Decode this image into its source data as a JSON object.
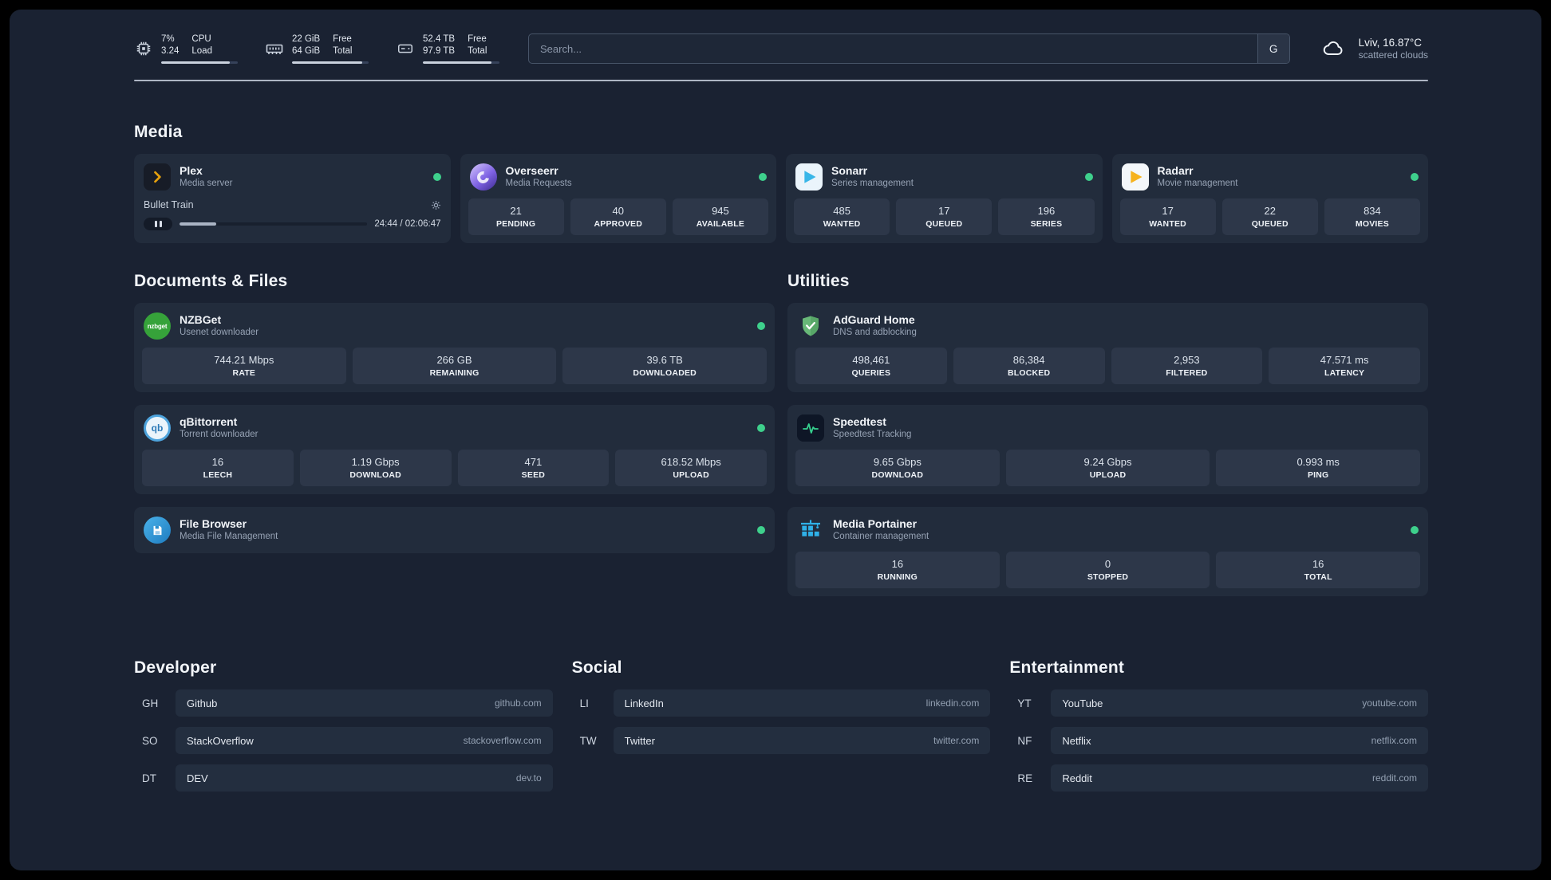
{
  "colors": {
    "status_online": "#3ed08c",
    "accent_plex": "#e5a00d",
    "accent_sonarr": "#38b6e8",
    "accent_radarr": "#f6b21e",
    "accent_adguard": "#68b878",
    "accent_speedtest": "#36d28f",
    "accent_portainer": "#2fb1e8"
  },
  "topbar": {
    "resources": [
      {
        "icon": "cpu-icon",
        "value_top": "7%",
        "value_bottom": "3.24",
        "label_top": "CPU",
        "label_bottom": "Load",
        "percent": 90
      },
      {
        "icon": "memory-icon",
        "value_top": "22 GiB",
        "value_bottom": "64 GiB",
        "label_top": "Free",
        "label_bottom": "Total",
        "percent": 92
      },
      {
        "icon": "disk-icon",
        "value_top": "52.4 TB",
        "value_bottom": "97.9 TB",
        "label_top": "Free",
        "label_bottom": "Total",
        "percent": 90
      }
    ],
    "search": {
      "placeholder": "Search...",
      "provider_label": "G"
    },
    "weather": {
      "line1": "Lviv, 16.87°C",
      "line2": "scattered clouds"
    }
  },
  "media": {
    "title": "Media",
    "plex": {
      "name": "Plex",
      "desc": "Media server",
      "player": {
        "track": "Bullet Train",
        "time": "24:44 / 02:06:47",
        "progress_percent": 19.5
      }
    },
    "overseerr": {
      "name": "Overseerr",
      "desc": "Media Requests",
      "stats": [
        {
          "value": "21",
          "label": "PENDING"
        },
        {
          "value": "40",
          "label": "APPROVED"
        },
        {
          "value": "945",
          "label": "AVAILABLE"
        }
      ]
    },
    "sonarr": {
      "name": "Sonarr",
      "desc": "Series management",
      "stats": [
        {
          "value": "485",
          "label": "WANTED"
        },
        {
          "value": "17",
          "label": "QUEUED"
        },
        {
          "value": "196",
          "label": "SERIES"
        }
      ]
    },
    "radarr": {
      "name": "Radarr",
      "desc": "Movie management",
      "stats": [
        {
          "value": "17",
          "label": "WANTED"
        },
        {
          "value": "22",
          "label": "QUEUED"
        },
        {
          "value": "834",
          "label": "MOVIES"
        }
      ]
    }
  },
  "documents": {
    "title": "Documents & Files",
    "nzbget": {
      "name": "NZBGet",
      "desc": "Usenet downloader",
      "icon_text": "nzbget",
      "stats": [
        {
          "value": "744.21 Mbps",
          "label": "RATE"
        },
        {
          "value": "266 GB",
          "label": "REMAINING"
        },
        {
          "value": "39.6 TB",
          "label": "DOWNLOADED"
        }
      ]
    },
    "qbittorrent": {
      "name": "qBittorrent",
      "desc": "Torrent downloader",
      "icon_text": "qb",
      "stats": [
        {
          "value": "16",
          "label": "LEECH"
        },
        {
          "value": "1.19 Gbps",
          "label": "DOWNLOAD"
        },
        {
          "value": "471",
          "label": "SEED"
        },
        {
          "value": "618.52 Mbps",
          "label": "UPLOAD"
        }
      ]
    },
    "filebrowser": {
      "name": "File Browser",
      "desc": "Media File Management"
    }
  },
  "utilities": {
    "title": "Utilities",
    "adguard": {
      "name": "AdGuard Home",
      "desc": "DNS and adblocking",
      "stats": [
        {
          "value": "498,461",
          "label": "QUERIES"
        },
        {
          "value": "86,384",
          "label": "BLOCKED"
        },
        {
          "value": "2,953",
          "label": "FILTERED"
        },
        {
          "value": "47.571 ms",
          "label": "LATENCY"
        }
      ]
    },
    "speedtest": {
      "name": "Speedtest",
      "desc": "Speedtest Tracking",
      "stats": [
        {
          "value": "9.65 Gbps",
          "label": "DOWNLOAD"
        },
        {
          "value": "9.24 Gbps",
          "label": "UPLOAD"
        },
        {
          "value": "0.993 ms",
          "label": "PING"
        }
      ]
    },
    "portainer": {
      "name": "Media Portainer",
      "desc": "Container management",
      "stats": [
        {
          "value": "16",
          "label": "RUNNING"
        },
        {
          "value": "0",
          "label": "STOPPED"
        },
        {
          "value": "16",
          "label": "TOTAL"
        }
      ]
    }
  },
  "bookmarks": [
    {
      "title": "Developer",
      "items": [
        {
          "abbr": "GH",
          "name": "Github",
          "url": "github.com"
        },
        {
          "abbr": "SO",
          "name": "StackOverflow",
          "url": "stackoverflow.com"
        },
        {
          "abbr": "DT",
          "name": "DEV",
          "url": "dev.to"
        }
      ]
    },
    {
      "title": "Social",
      "items": [
        {
          "abbr": "LI",
          "name": "LinkedIn",
          "url": "linkedin.com"
        },
        {
          "abbr": "TW",
          "name": "Twitter",
          "url": "twitter.com"
        }
      ]
    },
    {
      "title": "Entertainment",
      "items": [
        {
          "abbr": "YT",
          "name": "YouTube",
          "url": "youtube.com"
        },
        {
          "abbr": "NF",
          "name": "Netflix",
          "url": "netflix.com"
        },
        {
          "abbr": "RE",
          "name": "Reddit",
          "url": "reddit.com"
        }
      ]
    }
  ]
}
